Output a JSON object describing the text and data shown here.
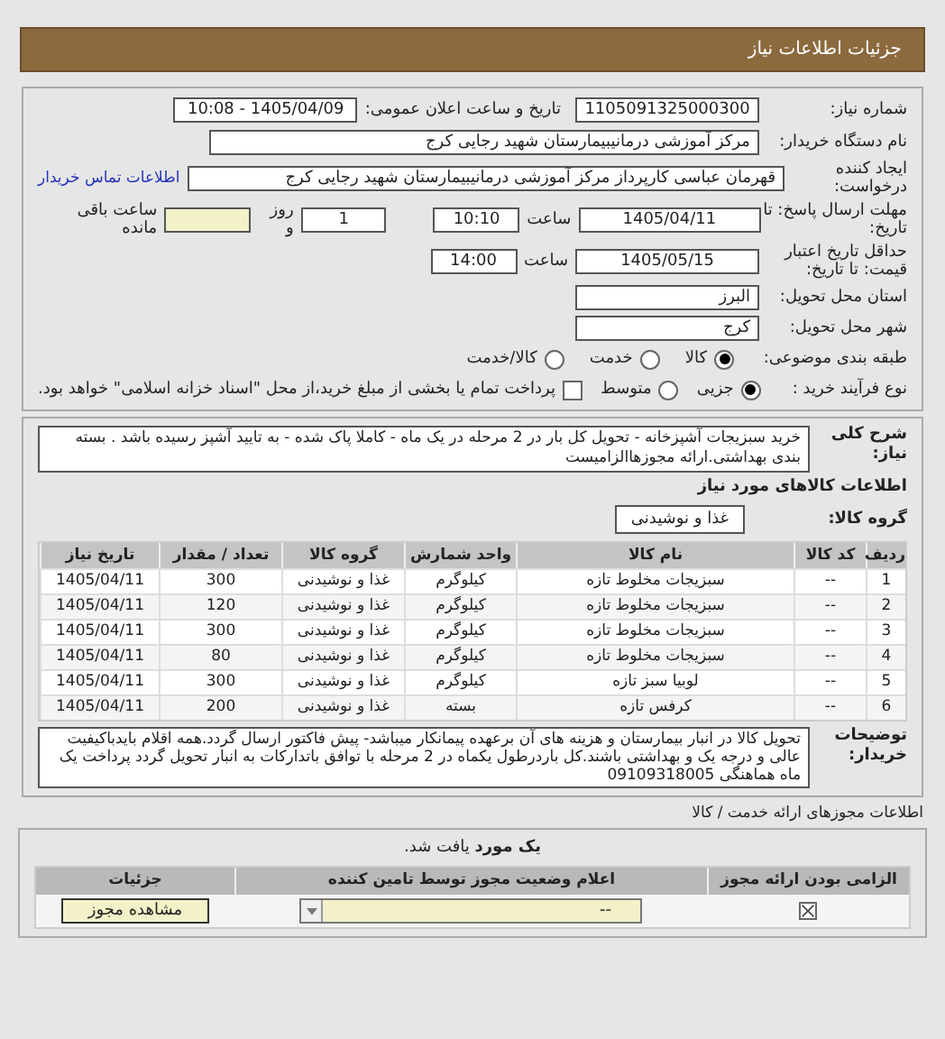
{
  "header": {
    "title": "جزئیات اطلاعات نیاز"
  },
  "need_number": {
    "label": "شماره نیاز:",
    "value": "1105091325000300"
  },
  "announce": {
    "label": "تاریخ و ساعت اعلان عمومی:",
    "value": "1405/04/09 - 10:08"
  },
  "buyer": {
    "label": "نام دستگاه خریدار:",
    "value": "مرکز آموزشی درمانیبیمارستان شهید رجایی کرج"
  },
  "creator": {
    "label": "ایجاد کننده درخواست:",
    "value": "قهرمان عباسی کارپرداز مرکز آموزشی درمانیبیمارستان شهید رجایی کرج",
    "link": "اطلاعات تماس خریدار"
  },
  "deadline": {
    "label": "مهلت ارسال پاسخ: تا تاریخ:",
    "date": "1405/04/11",
    "time_label": "ساعت",
    "time": "10:10",
    "days": "1",
    "days_label": "روز و",
    "remaining_label": "ساعت باقی مانده"
  },
  "validity": {
    "label": "حداقل تاریخ اعتبار قیمت: تا تاریخ:",
    "date": "1405/05/15",
    "time_label": "ساعت",
    "time": "14:00"
  },
  "province": {
    "label": "استان محل تحویل:",
    "value": "البرز"
  },
  "city": {
    "label": "شهر محل تحویل:",
    "value": "کرج"
  },
  "category": {
    "label": "طبقه بندی موضوعی:",
    "options": [
      {
        "label": "کالا",
        "selected": true
      },
      {
        "label": "خدمت",
        "selected": false
      },
      {
        "label": "کالا/خدمت",
        "selected": false
      }
    ]
  },
  "process": {
    "label": "نوع فرآیند خرید :",
    "options": [
      {
        "label": "جزیی",
        "selected": true
      },
      {
        "label": "متوسط",
        "selected": false
      }
    ],
    "checkbox": {
      "label": "پرداخت تمام یا بخشی از مبلغ خرید،از محل \"اسناد خزانه اسلامی\" خواهد بود.",
      "checked": false
    }
  },
  "description": {
    "label": "شرح کلی نیاز:",
    "value": "خرید سبزیجات آشپزخانه - تحویل کل بار در 2 مرحله در یک ماه - کاملا پاک شده - به تایید آشپز رسیده باشد . بسته بندی بهداشتی.ارائه مجوزهاالزامیست"
  },
  "goods_heading": "اطلاعات کالاهای مورد نیاز",
  "goods_group": {
    "label": "گروه کالا:",
    "value": "غذا و نوشیدنی"
  },
  "table": {
    "columns": [
      "ردیف",
      "کد کالا",
      "نام کالا",
      "واحد شمارش",
      "گروه کالا",
      "تعداد / مقدار",
      "تاریخ نیاز"
    ],
    "rows": [
      [
        "1",
        "--",
        "سبزیجات مخلوط تازه",
        "کیلوگرم",
        "غذا و نوشیدنی",
        "300",
        "1405/04/11"
      ],
      [
        "2",
        "--",
        "سبزیجات مخلوط تازه",
        "کیلوگرم",
        "غذا و نوشیدنی",
        "120",
        "1405/04/11"
      ],
      [
        "3",
        "--",
        "سبزیجات مخلوط تازه",
        "کیلوگرم",
        "غذا و نوشیدنی",
        "300",
        "1405/04/11"
      ],
      [
        "4",
        "--",
        "سبزیجات مخلوط تازه",
        "کیلوگرم",
        "غذا و نوشیدنی",
        "80",
        "1405/04/11"
      ],
      [
        "5",
        "--",
        "لوبیا سبز تازه",
        "کیلوگرم",
        "غذا و نوشیدنی",
        "300",
        "1405/04/11"
      ],
      [
        "6",
        "--",
        "کرفس تازه",
        "بسته",
        "غذا و نوشیدنی",
        "200",
        "1405/04/11"
      ]
    ]
  },
  "notes": {
    "label": "توضیحات خریدار:",
    "value": "تحویل کالا در انبار بیمارستان و هزینه های آن برعهده پیمانکار میباشد- پیش فاکتور ارسال گردد.همه اقلام بایدباکیفیت عالی و درجه یک و بهداشتی باشند.کل باردرطول یکماه در 2 مرحله با توافق باتدارکات به انبار تحویل گردد پرداخت یک ماه هماهنگی 09109318005"
  },
  "permits": {
    "heading": "اطلاعات مجوزهای ارائه خدمت / کالا",
    "found": "**یک مورد** یافت شد.",
    "columns": [
      "الزامی بودن ارائه مجوز",
      "اعلام وضعیت مجوز توسط تامین کننده",
      "جزئیات"
    ],
    "rows": [
      {
        "required": true,
        "status": "--",
        "button": "مشاهده مجوز"
      }
    ]
  }
}
